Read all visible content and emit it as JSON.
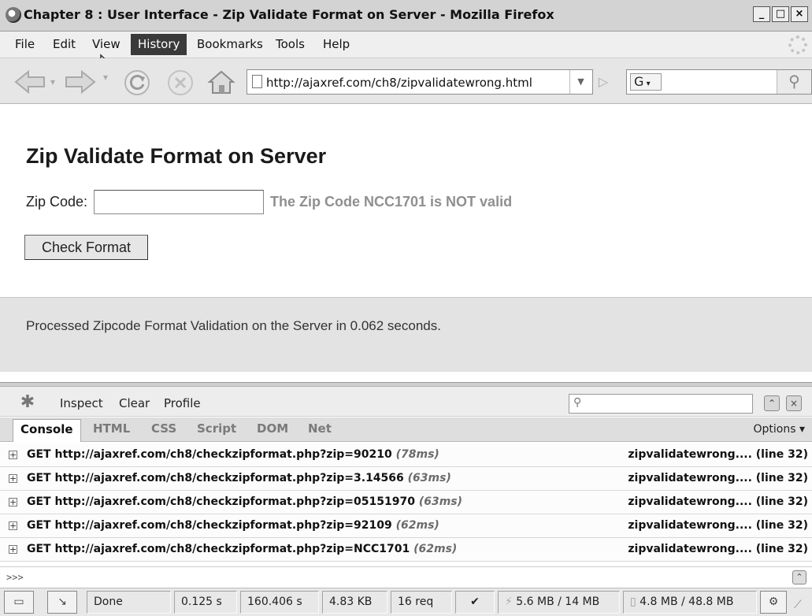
{
  "window": {
    "title": "Chapter 8 : User Interface - Zip Validate Format on Server - Mozilla Firefox",
    "controls": {
      "minimize": "_",
      "maximize": "□",
      "close": "×"
    }
  },
  "menu": [
    "File",
    "Edit",
    "View",
    "History",
    "Bookmarks",
    "Tools",
    "Help"
  ],
  "nav": {
    "url": "http://ajaxref.com/ch8/zipvalidatewrong.html",
    "search_engine": "G",
    "search_value": ""
  },
  "page": {
    "heading": "Zip Validate Format on Server",
    "zip_label": "Zip Code:",
    "zip_value": "",
    "zip_message": "The Zip Code NCC1701 is NOT valid",
    "button_label": "Check Format",
    "status": "Processed Zipcode Format Validation on the Server in 0.062 seconds."
  },
  "firebug": {
    "toolbar": [
      "Inspect",
      "Clear",
      "Profile"
    ],
    "tabs": [
      "Console",
      "HTML",
      "CSS",
      "Script",
      "DOM",
      "Net"
    ],
    "active_tab": "Console",
    "options_label": "Options ▾",
    "console_rows": [
      {
        "request": "GET http://ajaxref.com/ch8/checkzipformat.php?zip=90210",
        "time": "(78ms)",
        "source": "zipvalidatewrong.... (line 32)"
      },
      {
        "request": "GET http://ajaxref.com/ch8/checkzipformat.php?zip=3.14566",
        "time": "(63ms)",
        "source": "zipvalidatewrong.... (line 32)"
      },
      {
        "request": "GET http://ajaxref.com/ch8/checkzipformat.php?zip=05151970",
        "time": "(63ms)",
        "source": "zipvalidatewrong.... (line 32)"
      },
      {
        "request": "GET http://ajaxref.com/ch8/checkzipformat.php?zip=92109",
        "time": "(62ms)",
        "source": "zipvalidatewrong.... (line 32)"
      },
      {
        "request": "GET http://ajaxref.com/ch8/checkzipformat.php?zip=NCC1701",
        "time": "(62ms)",
        "source": "zipvalidatewrong.... (line 32)"
      }
    ],
    "prompt": ">>>"
  },
  "statusbar": {
    "status": "Done",
    "load_time": "0.125 s",
    "total_time": "160.406 s",
    "size": "4.83 KB",
    "requests": "16 req",
    "memory_1": "5.6 MB / 14 MB",
    "memory_2": "4.8 MB / 48.8 MB"
  }
}
